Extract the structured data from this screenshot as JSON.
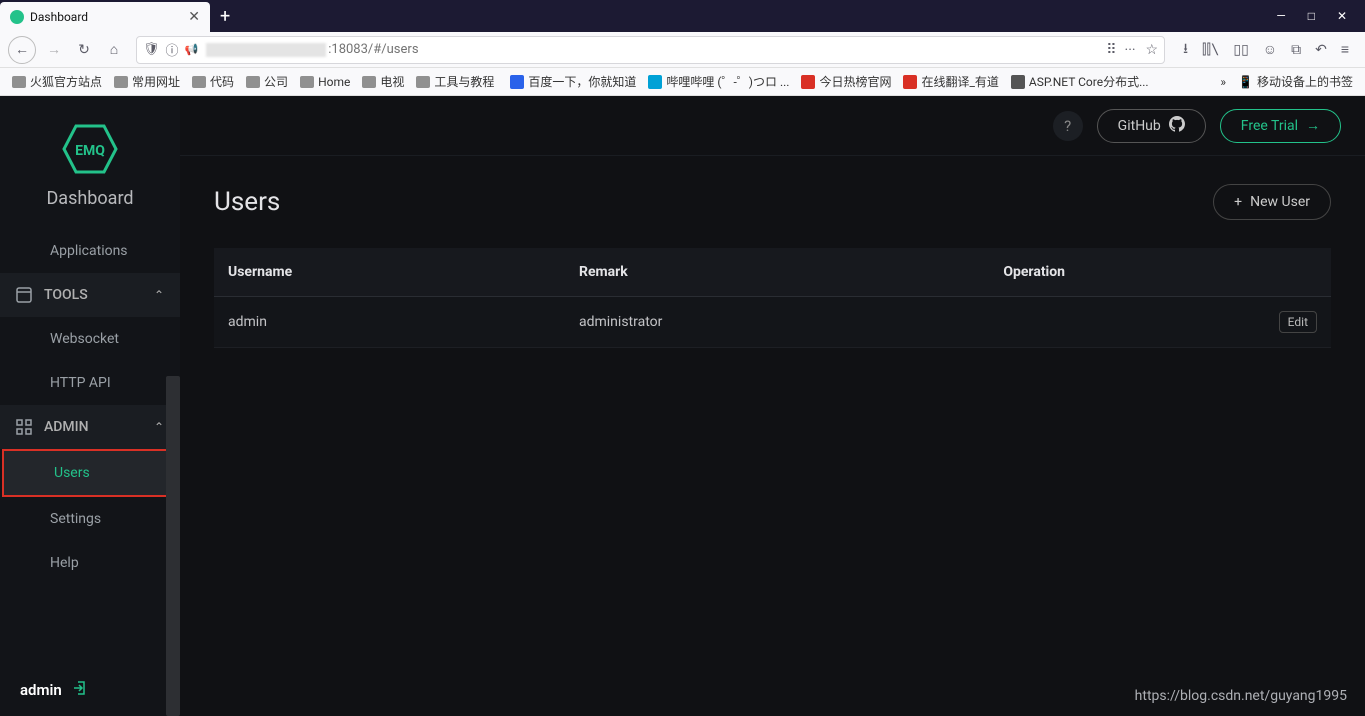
{
  "browser": {
    "tab_title": "Dashboard",
    "url_suffix": ":18083/#/users",
    "window_controls": {
      "min": "—",
      "max": "□",
      "close": "✕"
    }
  },
  "bookmarks": {
    "folders": [
      "火狐官方站点",
      "常用网址",
      "代码",
      "公司",
      "Home",
      "电视",
      "工具与教程"
    ],
    "links": [
      {
        "label": "百度一下，你就知道",
        "color": "#2a62ea"
      },
      {
        "label": "哔哩哔哩 (゜-゜)つロ ...",
        "color": "#00a1d6"
      },
      {
        "label": "今日热榜官网",
        "color": "#d93025"
      },
      {
        "label": "在线翻译_有道",
        "color": "#d93025"
      },
      {
        "label": "ASP.NET Core分布式...",
        "color": "#555"
      }
    ],
    "overflow": "»",
    "mobile": "移动设备上的书签"
  },
  "sidebar": {
    "brand_logo_text": "EMQ",
    "brand": "Dashboard",
    "nav_applications": "Applications",
    "section_tools": "TOOLS",
    "nav_websocket": "Websocket",
    "nav_httpapi": "HTTP API",
    "section_admin": "ADMIN",
    "nav_users": "Users",
    "nav_settings": "Settings",
    "nav_help": "Help",
    "footer_user": "admin"
  },
  "topbar": {
    "github": "GitHub",
    "free_trial": "Free Trial"
  },
  "page": {
    "title": "Users",
    "new_user": "New User"
  },
  "table": {
    "headers": {
      "username": "Username",
      "remark": "Remark",
      "operation": "Operation"
    },
    "rows": [
      {
        "username": "admin",
        "remark": "administrator",
        "action": "Edit"
      }
    ]
  },
  "watermark": "https://blog.csdn.net/guyang1995"
}
